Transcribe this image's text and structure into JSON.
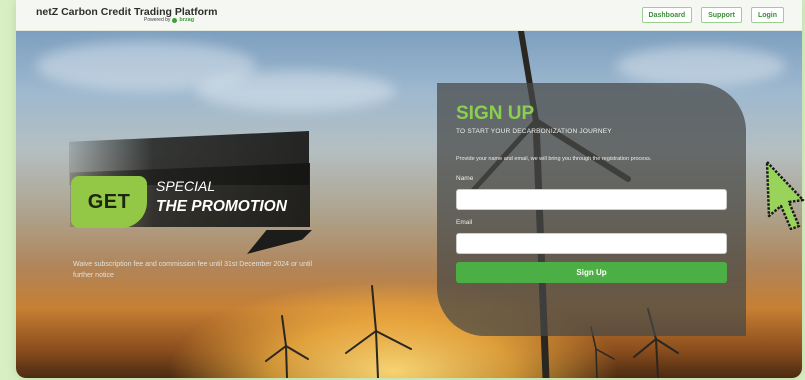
{
  "header": {
    "title": "netZ Carbon Credit Trading Platform",
    "powered_by": "Powered by",
    "powered_brand": "brzag",
    "nav": [
      {
        "label": "Dashboard"
      },
      {
        "label": "Support"
      },
      {
        "label": "Login"
      }
    ]
  },
  "promo": {
    "get": "GET",
    "special": "SPECIAL",
    "the_promotion": "THE PROMOTION",
    "note": "Waive subscription fee and commission fee until 31st December 2024 or until further notice"
  },
  "signup": {
    "title": "SIGN UP",
    "subtitle": "TO START YOUR DECARBONIZATION JOURNEY",
    "description": "Provide your name and email, we will bring you through the registration process.",
    "name_label": "Name",
    "name_value": "",
    "email_label": "Email",
    "email_value": "",
    "button_label": "Sign Up"
  },
  "colors": {
    "accent": "#4caf45",
    "accent_light": "#8ad04e",
    "promo_badge": "#93c846",
    "nav_border": "#9dcf8f"
  },
  "icons": {
    "cursor": "arrow-cursor-icon",
    "brand_logo": "leaf-logo-icon"
  }
}
